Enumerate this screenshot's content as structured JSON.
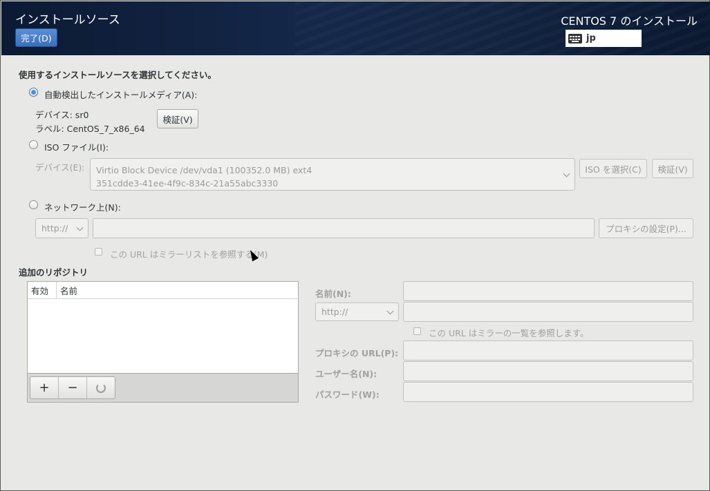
{
  "header": {
    "spoke_title": "インストールソース",
    "done_label": "完了(D)",
    "product_title": "CENTOS 7 のインストール",
    "keyboard_layout": "jp"
  },
  "source": {
    "heading": "使用するインストールソースを選択してください。",
    "auto_media": {
      "label": "自動検出したインストールメディア(A):",
      "selected": true,
      "device_line": "デバイス: sr0",
      "label_line": "ラベル: CentOS_7_x86_64",
      "verify_label": "検証(V)"
    },
    "iso": {
      "label": "ISO ファイル(I):",
      "selected": false,
      "device_label": "デバイス(E):",
      "device_line1": "Virtio Block Device /dev/vda1 (100352.0 MB) ext4",
      "device_line2": "351cdde3-41ee-4f9c-834c-21a55abc3330",
      "choose_label": "ISO を選択(C)",
      "verify_label": "検証(V)"
    },
    "network": {
      "label": "ネットワーク上(N):",
      "selected": false,
      "protocol": "http://",
      "url_value": "",
      "proxy_label": "プロキシの設定(P)...",
      "mirror_label": "この URL はミラーリストを参照する(M)"
    }
  },
  "repos": {
    "heading": "追加のリポジトリ",
    "columns": [
      "有効",
      "名前"
    ],
    "rows": [],
    "name_label": "名前(N):",
    "protocol": "http://",
    "mirror_label": "この URL はミラーの一覧を参照します。",
    "proxy_url_label": "プロキシの URL(P):",
    "username_label": "ユーザー名(N):",
    "password_label": "パスワード(W):"
  },
  "colors": {
    "header_bg": "#122440",
    "accent": "#4a90d9",
    "done_button": "#3a6fbd"
  }
}
